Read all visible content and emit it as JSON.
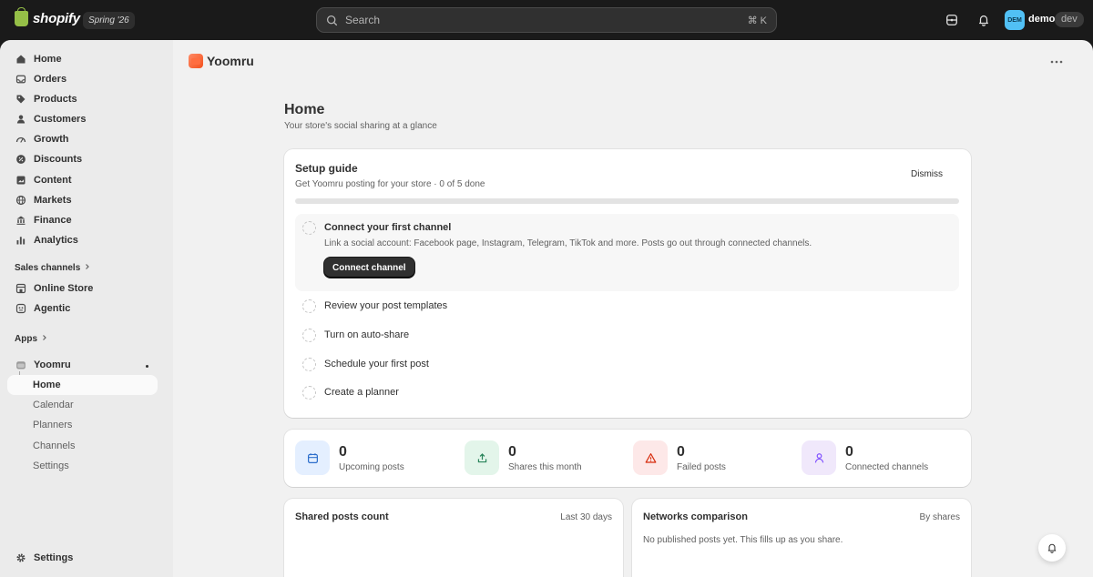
{
  "topbar": {
    "brand": "shopify",
    "edition": "Spring '26",
    "search_placeholder": "Search",
    "search_shortcut": "⌘  K",
    "avatar_initials": "DEM",
    "store_name": "demo",
    "env_badge": "dev"
  },
  "sidebar": {
    "items": [
      {
        "label": "Home",
        "icon": "home-icon"
      },
      {
        "label": "Orders",
        "icon": "inbox-icon"
      },
      {
        "label": "Products",
        "icon": "tag-icon"
      },
      {
        "label": "Customers",
        "icon": "person-icon"
      },
      {
        "label": "Growth",
        "icon": "gauge-icon"
      },
      {
        "label": "Discounts",
        "icon": "discount-icon"
      },
      {
        "label": "Content",
        "icon": "content-icon"
      },
      {
        "label": "Markets",
        "icon": "globe-icon"
      },
      {
        "label": "Finance",
        "icon": "bank-icon"
      },
      {
        "label": "Analytics",
        "icon": "bar-chart-icon"
      }
    ],
    "sales_channels_label": "Sales channels",
    "channels": [
      {
        "label": "Online Store",
        "icon": "store-icon"
      },
      {
        "label": "Agentic",
        "icon": "agentic-icon"
      }
    ],
    "apps_label": "Apps",
    "app_name": "Yoomru",
    "app_subitems": [
      "Home",
      "Calendar",
      "Planners",
      "Channels",
      "Settings"
    ],
    "settings_label": "Settings"
  },
  "app": {
    "title": "Yoomru"
  },
  "page": {
    "title": "Home",
    "subtitle": "Your store's social sharing at a glance"
  },
  "setup": {
    "title": "Setup guide",
    "subtitle": "Get Yoomru posting for your store · 0 of 5 done",
    "dismiss_label": "Dismiss",
    "progress_fraction": 0,
    "active_step": {
      "title": "Connect your first channel",
      "description": "Link a social account: Facebook page, Instagram, Telegram, TikTok and more. Posts go out through connected channels.",
      "button": "Connect channel"
    },
    "steps": [
      "Review your post templates",
      "Turn on auto-share",
      "Schedule your first post",
      "Create a planner"
    ]
  },
  "stats": [
    {
      "value": "0",
      "label": "Upcoming posts",
      "icon": "calendar-icon",
      "bg": "#e4efff",
      "fg": "#2c6ecb"
    },
    {
      "value": "0",
      "label": "Shares this month",
      "icon": "share-icon",
      "bg": "#e3f5ea",
      "fg": "#29845a"
    },
    {
      "value": "0",
      "label": "Failed posts",
      "icon": "alert-triangle-icon",
      "bg": "#fde8e8",
      "fg": "#d72c0d"
    },
    {
      "value": "0",
      "label": "Connected channels",
      "icon": "person-icon",
      "bg": "#f0e8fb",
      "fg": "#8051ff"
    }
  ],
  "shared_posts": {
    "title": "Shared posts count",
    "range": "Last 30 days"
  },
  "networks": {
    "title": "Networks comparison",
    "sort": "By shares",
    "empty": "No published posts yet. This fills up as you share."
  }
}
